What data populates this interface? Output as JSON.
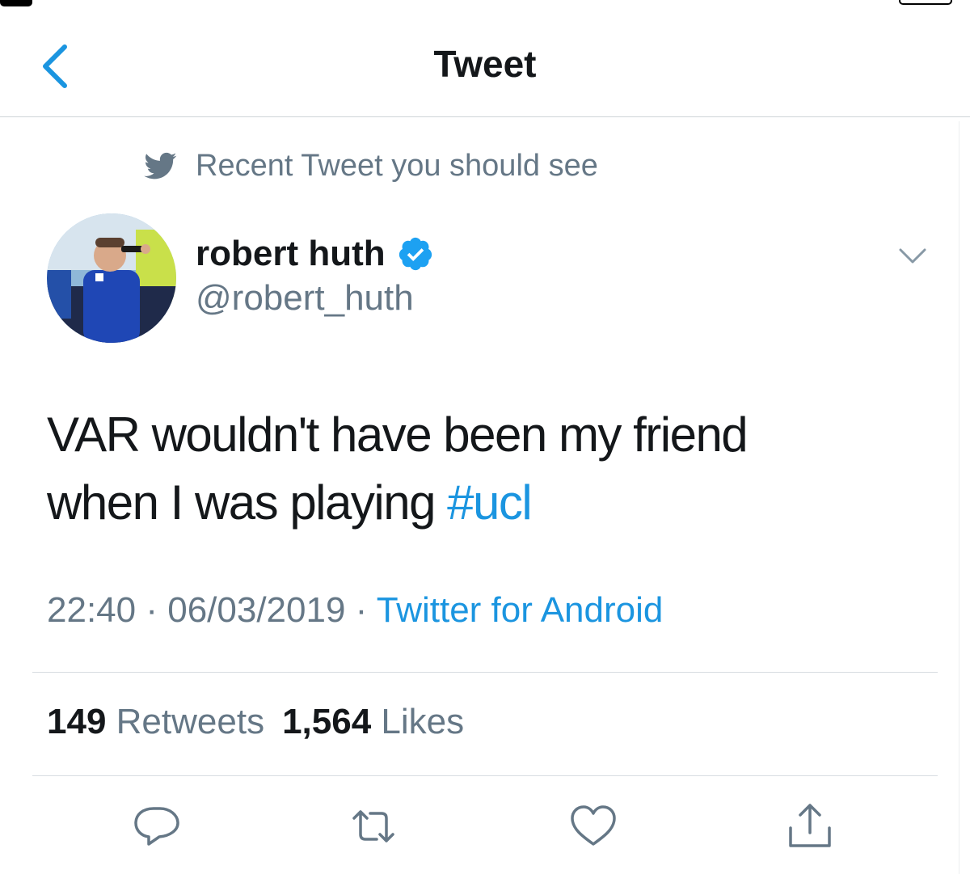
{
  "nav": {
    "title": "Tweet"
  },
  "context": {
    "label": "Recent Tweet you should see"
  },
  "author": {
    "display_name": "robert huth",
    "handle": "@robert_huth",
    "verified": true
  },
  "tweet": {
    "text_part1": "VAR wouldn't have been my friend",
    "text_part2": "when I was playing ",
    "hashtag": "#ucl"
  },
  "meta": {
    "time": "22:40",
    "separator1": " · ",
    "date": "06/03/2019",
    "separator2": " · ",
    "source": "Twitter for Android"
  },
  "stats": {
    "retweets_count": "149",
    "retweets_label": "Retweets",
    "likes_count": "1,564",
    "likes_label": "Likes"
  },
  "icons": {
    "back": "chevron-left-icon",
    "context": "twitter-bird-icon",
    "verified": "verified-badge-icon",
    "caret": "chevron-down-icon",
    "reply": "reply-icon",
    "retweet": "retweet-icon",
    "like": "heart-icon",
    "share": "share-icon"
  },
  "colors": {
    "accent": "#1b95e0",
    "text_primary": "#14171a",
    "text_secondary": "#657786",
    "divider": "#d8dde1"
  }
}
